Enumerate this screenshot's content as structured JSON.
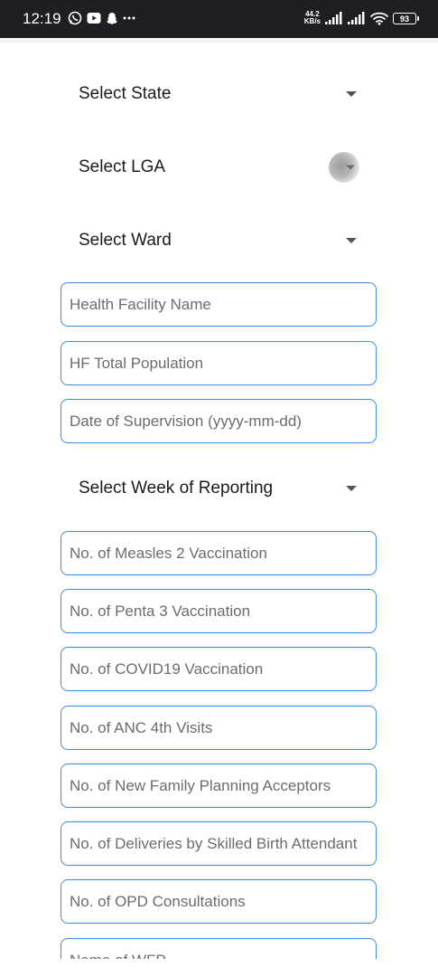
{
  "status_bar": {
    "time": "12:19",
    "left_icons": [
      "whatsapp-icon",
      "youtube-icon",
      "snapchat-icon",
      "more-dots-icon"
    ],
    "network_speed_value": "44.2",
    "network_speed_unit": "KB/s",
    "battery_level": "93"
  },
  "form": {
    "selects": {
      "state": "Select State",
      "lga": "Select LGA",
      "ward": "Select Ward",
      "week": "Select Week of Reporting"
    },
    "fields": {
      "health_facility_name": "Health Facility Name",
      "hf_total_population": "HF Total Population",
      "date_of_supervision": "Date of Supervision (yyyy-mm-dd)",
      "measles2": "No. of Measles 2 Vaccination",
      "penta3": "No. of Penta 3 Vaccination",
      "covid19": "No. of COVID19 Vaccination",
      "anc4": "No. of ANC 4th Visits",
      "family_planning": "No. of New Family Planning Acceptors",
      "skilled_birth": "No. of Deliveries by Skilled Birth Attendant",
      "opd": "No. of OPD Consultations",
      "name_of_wfp_partial": "Name of WFP"
    }
  }
}
